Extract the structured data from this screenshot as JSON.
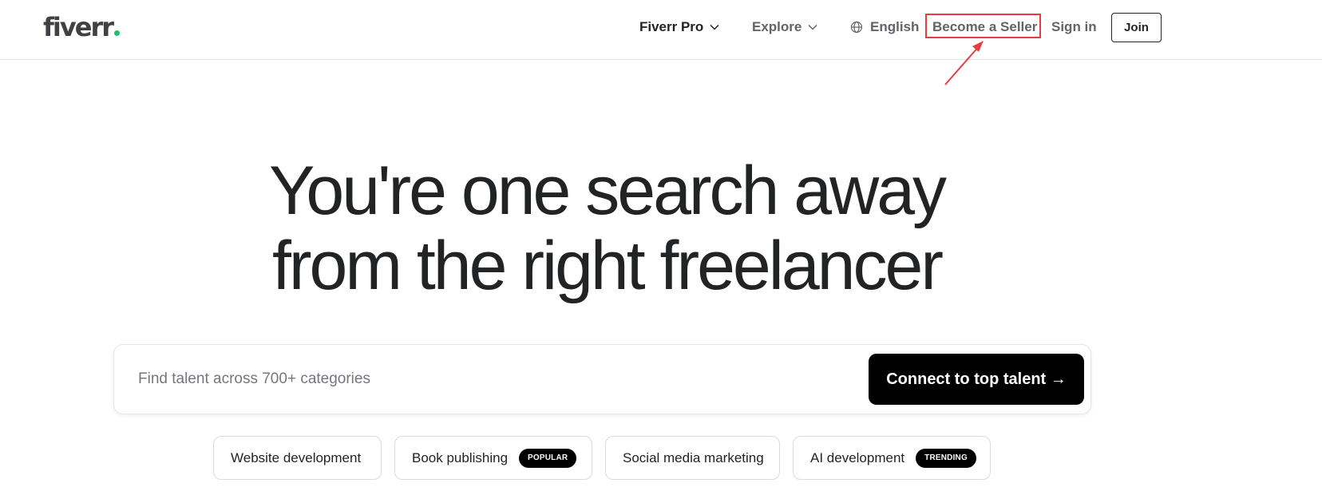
{
  "header": {
    "logo": "fiverr",
    "nav": {
      "pro": "Fiverr Pro",
      "explore": "Explore",
      "language": "English",
      "become_seller": "Become a Seller",
      "sign_in": "Sign in",
      "join": "Join"
    }
  },
  "hero": {
    "headline_line1": "You're one search away",
    "headline_line2": "from the right freelancer"
  },
  "search": {
    "placeholder": "Find talent across 700+ categories",
    "button_label": "Connect to top talent →"
  },
  "chips": [
    {
      "label": "Website development",
      "badge": ""
    },
    {
      "label": "Book publishing",
      "badge": "POPULAR"
    },
    {
      "label": "Social media marketing",
      "badge": ""
    },
    {
      "label": "AI development",
      "badge": "TRENDING"
    }
  ],
  "colors": {
    "brand_green": "#1dbf73",
    "annotation_red": "#e53e3e",
    "button_black": "#000000"
  },
  "icons": [
    "chevron-down-icon",
    "globe-icon",
    "arrow-right-icon"
  ]
}
